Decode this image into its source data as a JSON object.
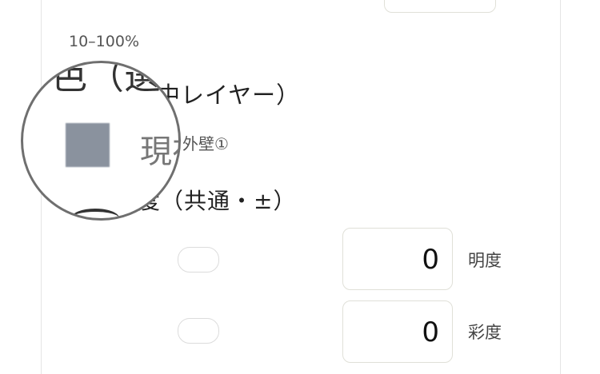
{
  "opacity_range": "10–100%",
  "heading_color_fragment": "中レイヤー）",
  "current_layer_label": "外壁①",
  "heading_adjust_fragment": "度（共通・±）",
  "magnifier": {
    "top_text": "色（選",
    "mid_text": "現在",
    "swatch_color": "#8a929e"
  },
  "brightness": {
    "value": "0",
    "label": "明度"
  },
  "saturation": {
    "value": "0",
    "label": "彩度"
  }
}
